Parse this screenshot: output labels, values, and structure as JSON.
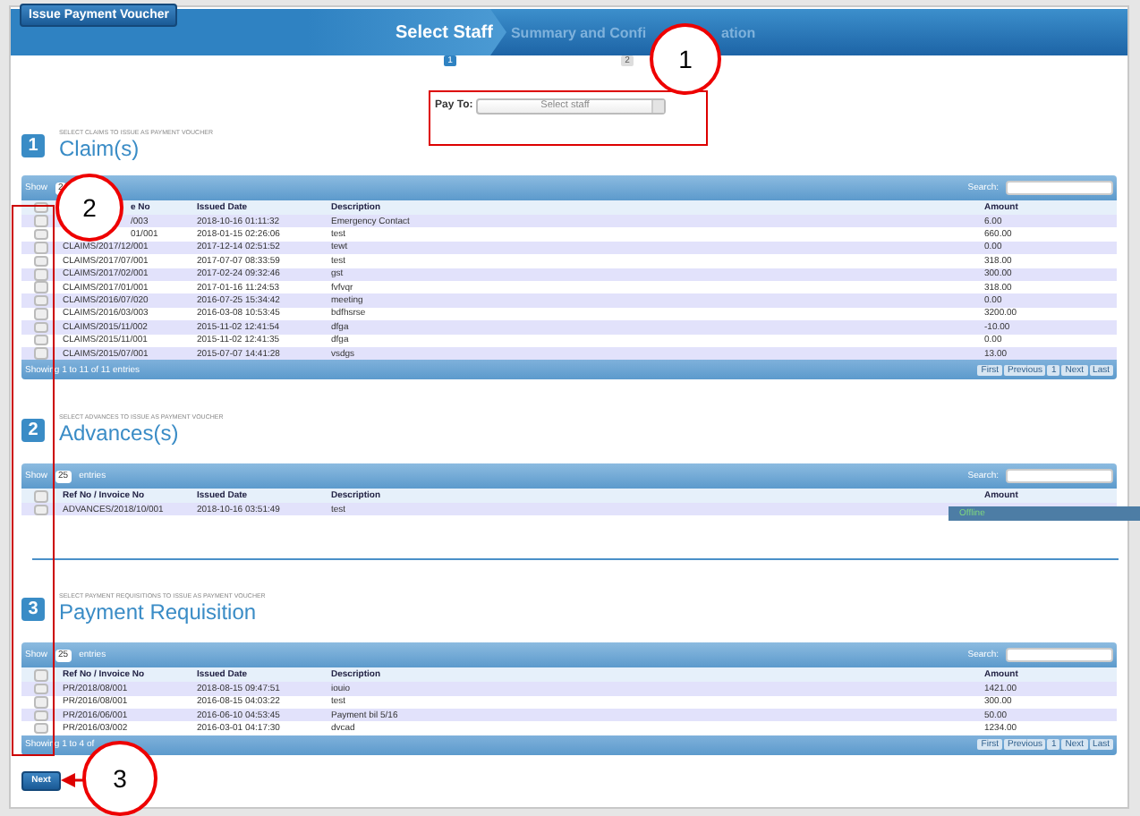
{
  "top_button": "Issue Payment Voucher",
  "steps": [
    {
      "label_parts": [
        "Select Staff"
      ],
      "number": "1",
      "selected": true
    },
    {
      "label_parts": [
        "Summary and Confi",
        "ation"
      ],
      "number": "2",
      "selected": false
    }
  ],
  "pay_to": {
    "label": "Pay To:",
    "placeholder": "Select staff"
  },
  "sections": [
    {
      "number": "1",
      "hint": "SELECT CLAIMS TO ISSUE AS PAYMENT VOUCHER",
      "title": "Claim(s)",
      "table": {
        "show_label": "Show",
        "show_value": "2",
        "search_label": "Search:",
        "all_checked": false,
        "columns": [
          {
            "label": "e No",
            "kind": "cut"
          },
          {
            "label": "Issued Date",
            "kind": "whole"
          },
          {
            "label": "Description",
            "kind": "whole"
          },
          {
            "label": "Amount",
            "kind": "whole"
          }
        ],
        "rows": [
          {
            "checked": false,
            "kind": "cut",
            "cells": [
              "/003",
              "2018-10-16 01:11:32",
              "Emergency Contact",
              "6.00"
            ]
          },
          {
            "checked": false,
            "kind": "cut",
            "cells": [
              "01/001",
              "2018-01-15 02:26:06",
              "test",
              "660.00"
            ]
          },
          {
            "checked": false,
            "kind": "whole",
            "cells": [
              "CLAIMS/2017/12/001",
              "2017-12-14 02:51:52",
              "tewt",
              "0.00"
            ]
          },
          {
            "checked": false,
            "kind": "whole",
            "cells": [
              "CLAIMS/2017/07/001",
              "2017-07-07 08:33:59",
              "test",
              "318.00"
            ]
          },
          {
            "checked": false,
            "kind": "whole",
            "cells": [
              "CLAIMS/2017/02/001",
              "2017-02-24 09:32:46",
              "gst",
              "300.00"
            ]
          },
          {
            "checked": false,
            "kind": "whole",
            "cells": [
              "CLAIMS/2017/01/001",
              "2017-01-16 11:24:53",
              "fvfvqr",
              "318.00"
            ]
          },
          {
            "checked": false,
            "kind": "whole",
            "cells": [
              "CLAIMS/2016/07/020",
              "2016-07-25 15:34:42",
              "meeting",
              "0.00"
            ]
          },
          {
            "checked": false,
            "kind": "whole",
            "cells": [
              "CLAIMS/2016/03/003",
              "2016-03-08 10:53:45",
              "bdfhsrse",
              "3200.00"
            ]
          },
          {
            "checked": false,
            "kind": "whole",
            "cells": [
              "CLAIMS/2015/11/002",
              "2015-11-02 12:41:54",
              "dfga",
              "-10.00"
            ]
          },
          {
            "checked": false,
            "kind": "whole",
            "cells": [
              "CLAIMS/2015/11/001",
              "2015-11-02 12:41:35",
              "dfga",
              "0.00"
            ]
          },
          {
            "checked": false,
            "kind": "whole",
            "cells": [
              "CLAIMS/2015/07/001",
              "2015-07-07 14:41:28",
              "vsdgs",
              "13.00"
            ]
          }
        ],
        "footer_info": "Showing 1 to 11 of 11 entries",
        "pager": [
          "First",
          "Previous",
          "1",
          "Next",
          "Last"
        ]
      }
    },
    {
      "number": "2",
      "hint": "SELECT ADVANCES TO ISSUE AS PAYMENT VOUCHER",
      "title": "Advances(s)",
      "table": {
        "show_label": "Show",
        "show_value": "25",
        "entries_label": "entries",
        "search_label": "Search:",
        "all_checked": false,
        "columns": [
          {
            "label": "Ref No / Invoice No"
          },
          {
            "label": "Issued Date"
          },
          {
            "label": "Description"
          },
          {
            "label": "Amount"
          }
        ],
        "rows": [
          {
            "checked": false,
            "cells": [
              "ADVANCES/2018/10/001",
              "2018-10-16 03:51:49",
              "test"
            ]
          }
        ]
      }
    },
    {
      "number": "3",
      "hint": "SELECT PAYMENT REQUISITIONS TO ISSUE AS PAYMENT VOUCHER",
      "title": "Payment Requisition",
      "table": {
        "show_label": "Show",
        "show_value": "25",
        "entries_label": "entries",
        "search_label": "Search:",
        "all_checked": false,
        "columns": [
          {
            "label": "Ref No / Invoice No"
          },
          {
            "label": "Issued Date"
          },
          {
            "label": "Description"
          },
          {
            "label": "Amount"
          }
        ],
        "rows": [
          {
            "checked": false,
            "cells": [
              "PR/2018/08/001",
              "2018-08-15 09:47:51",
              "iouio",
              "1421.00"
            ]
          },
          {
            "checked": false,
            "cells": [
              "PR/2016/08/001",
              "2016-08-15 04:03:22",
              "test",
              "300.00"
            ]
          },
          {
            "checked": false,
            "cells": [
              "PR/2016/06/001",
              "2016-06-10 04:53:45",
              "Payment bil 5/16",
              "50.00"
            ]
          },
          {
            "checked": false,
            "cells": [
              "PR/2016/03/002",
              "2016-03-01 04:17:30",
              "dvcad",
              "1234.00"
            ]
          }
        ],
        "footer_info": "Showing 1 to 4 of",
        "pager": [
          "First",
          "Previous",
          "1",
          "Next",
          "Last"
        ]
      }
    }
  ],
  "next_button": "Next",
  "chat": {
    "label": "Offline"
  },
  "callouts": [
    {
      "label": "1"
    },
    {
      "label": "2"
    },
    {
      "label": "3"
    }
  ]
}
